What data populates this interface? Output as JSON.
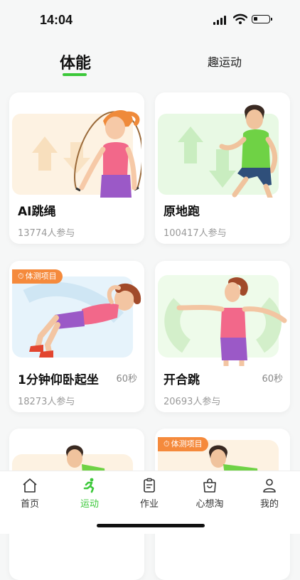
{
  "status": {
    "time": "14:04"
  },
  "tabs": {
    "active": "体能",
    "other": "趣运动"
  },
  "cards": [
    {
      "title": "AI跳绳",
      "participants": "13774人参与",
      "duration": "",
      "badge": ""
    },
    {
      "title": "原地跑",
      "participants": "100417人参与",
      "duration": "",
      "badge": ""
    },
    {
      "title": "1分钟仰卧起坐",
      "participants": "18273人参与",
      "duration": "60秒",
      "badge": "体测项目"
    },
    {
      "title": "开合跳",
      "participants": "20693人参与",
      "duration": "60秒",
      "badge": ""
    },
    {
      "title": "",
      "participants": "",
      "duration": "",
      "badge": ""
    },
    {
      "title": "",
      "participants": "",
      "duration": "",
      "badge": "体测项目"
    }
  ],
  "nav": [
    {
      "label": "首页",
      "icon": "home-icon"
    },
    {
      "label": "运动",
      "icon": "running-icon"
    },
    {
      "label": "作业",
      "icon": "clipboard-icon"
    },
    {
      "label": "心想淘",
      "icon": "shopping-bag-icon"
    },
    {
      "label": "我的",
      "icon": "person-icon"
    }
  ],
  "colors": {
    "accent": "#3cc83a",
    "badge": "#f58a3c"
  }
}
